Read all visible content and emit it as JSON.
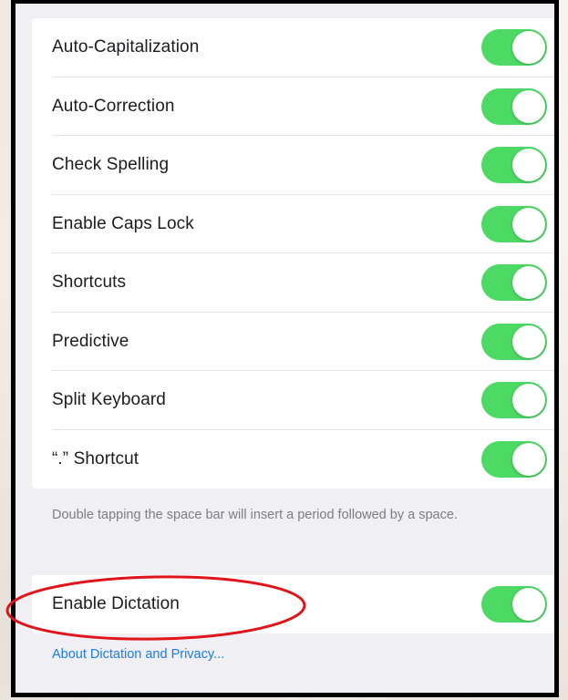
{
  "settings": {
    "rows": [
      {
        "label": "Auto-Capitalization",
        "on": true
      },
      {
        "label": "Auto-Correction",
        "on": true
      },
      {
        "label": "Check Spelling",
        "on": true
      },
      {
        "label": "Enable Caps Lock",
        "on": true
      },
      {
        "label": "Shortcuts",
        "on": true
      },
      {
        "label": "Predictive",
        "on": true
      },
      {
        "label": "Split Keyboard",
        "on": true
      },
      {
        "label": "“.” Shortcut",
        "on": true
      }
    ],
    "footnote": "Double tapping the space bar will insert a period followed by a space.",
    "dictation": {
      "label": "Enable Dictation",
      "on": true
    },
    "dictation_link": "About Dictation and Privacy..."
  },
  "colors": {
    "toggle_on": "#4cd964",
    "link": "#1a7cf5",
    "annotation": "#e0141b"
  }
}
